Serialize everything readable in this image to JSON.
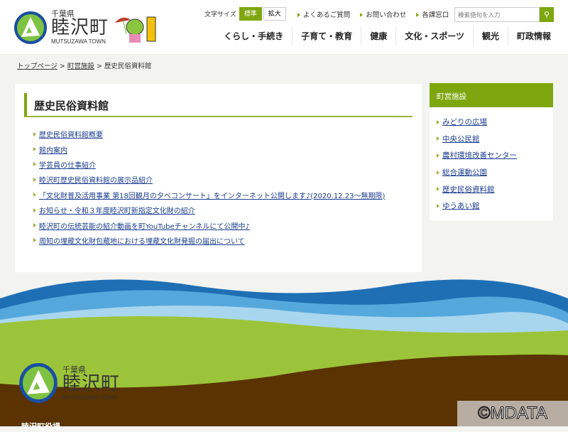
{
  "header": {
    "logo": {
      "pref": "千葉県",
      "name": "睦沢町",
      "en": "MUTSUZAWA TOWN"
    },
    "font_size_label": "文字サイズ",
    "font_size_standard": "標準",
    "font_size_large": "拡大",
    "util_links": [
      "よくあるご質問",
      "お問い合わせ",
      "各課窓口"
    ],
    "search_placeholder": "検索語句を入力",
    "nav": [
      "くらし・手続き",
      "子育て・教育",
      "健康",
      "文化・スポーツ",
      "観光",
      "町政情報"
    ]
  },
  "breadcrumb": {
    "home": "トップページ",
    "parent": "町営施設",
    "current": "歴史民俗資料館",
    "sep": ">"
  },
  "main": {
    "title": "歴史民俗資料館",
    "links": [
      "歴史民俗資料館概要",
      "館内案内",
      "学芸員の仕事紹介",
      "睦沢町歴史民俗資料館の展示品紹介",
      "「文化財普及活用事業 第18回観月の夕べコンサート」をインターネット公開します♪(2020.12.23～無期限)",
      "お知らせ・令和３年度睦沢町新指定文化財の紹介",
      "睦沢町の伝統芸能の紹介動画を町YouTubeチャンネルにて公開中♪",
      "周知の埋蔵文化財包蔵地における埋蔵文化財発掘の届出について"
    ]
  },
  "sidebar": {
    "title": "町営施設",
    "links": [
      "みどりの広場",
      "中央公民館",
      "農村環境改善センター",
      "総合運動公園",
      "歴史民俗資料館",
      "ゆうあい館"
    ]
  },
  "footer": {
    "logo": {
      "pref": "千葉県",
      "name": "睦沢町",
      "en": "MUTSUZAWA TOWN"
    },
    "office": "睦沢町役場"
  },
  "watermark": "©MDATA",
  "colors": {
    "accent": "#7ea60f",
    "footer_brown": "#5a3300"
  }
}
